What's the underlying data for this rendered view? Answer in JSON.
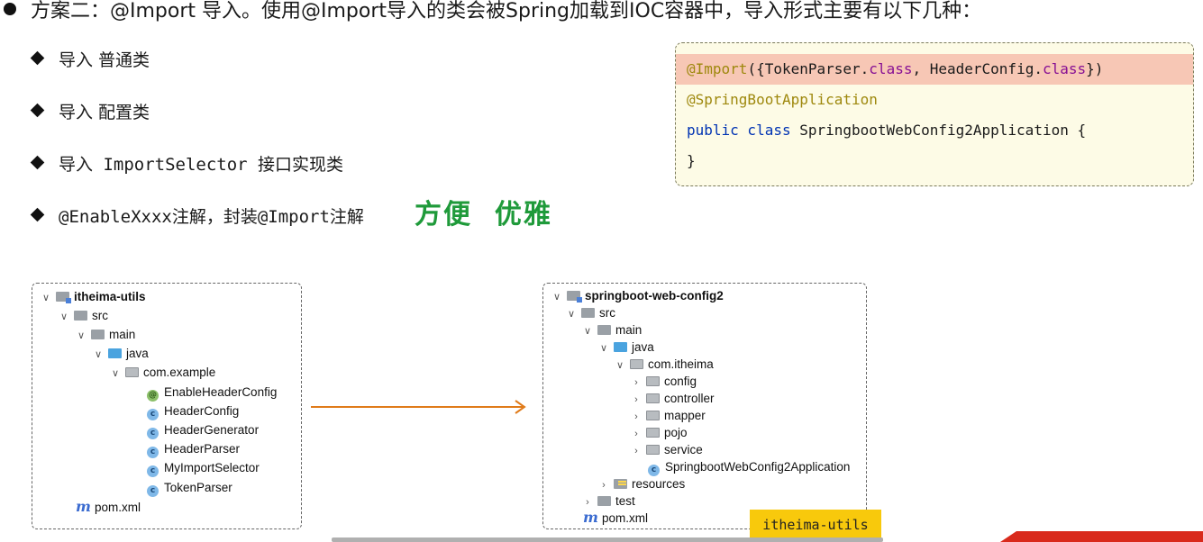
{
  "title": "方案二：@Import 导入。使用@Import导入的类会被Spring加载到IOC容器中，导入形式主要有以下几种：",
  "bullets": [
    "导入 普通类",
    "导入 配置类",
    "导入 ImportSelector 接口实现类",
    "@EnableXxxx注解，封装@Import注解"
  ],
  "handwriting": "方便  优雅",
  "code": {
    "line1_ann": "@Import",
    "line1_a": "({TokenParser.",
    "line1_kw1": "class",
    "line1_b": ", HeaderConfig.",
    "line1_kw2": "class",
    "line1_c": "})",
    "line2": "@SpringBootApplication",
    "line3_kw": "public class",
    "line3_rest": " SpringbootWebConfig2Application {",
    "line4": "}"
  },
  "left_tree": {
    "root": "itheima-utils",
    "src": "src",
    "main": "main",
    "java": "java",
    "package": "com.example",
    "classes": [
      "EnableHeaderConfig",
      "HeaderConfig",
      "HeaderGenerator",
      "HeaderParser",
      "MyImportSelector",
      "TokenParser"
    ],
    "pom": "pom.xml"
  },
  "right_tree": {
    "root": "springboot-web-config2",
    "src": "src",
    "main": "main",
    "java": "java",
    "package": "com.itheima",
    "subpackages": [
      "config",
      "controller",
      "mapper",
      "pojo",
      "service"
    ],
    "app_class": "SpringbootWebConfig2Application",
    "resources": "resources",
    "test": "test",
    "pom": "pom.xml"
  },
  "tag": "itheima-utils",
  "colors": {
    "arrow": "#e07b1a",
    "highlight": "#f7c7b5",
    "tag": "#f8c90c"
  }
}
